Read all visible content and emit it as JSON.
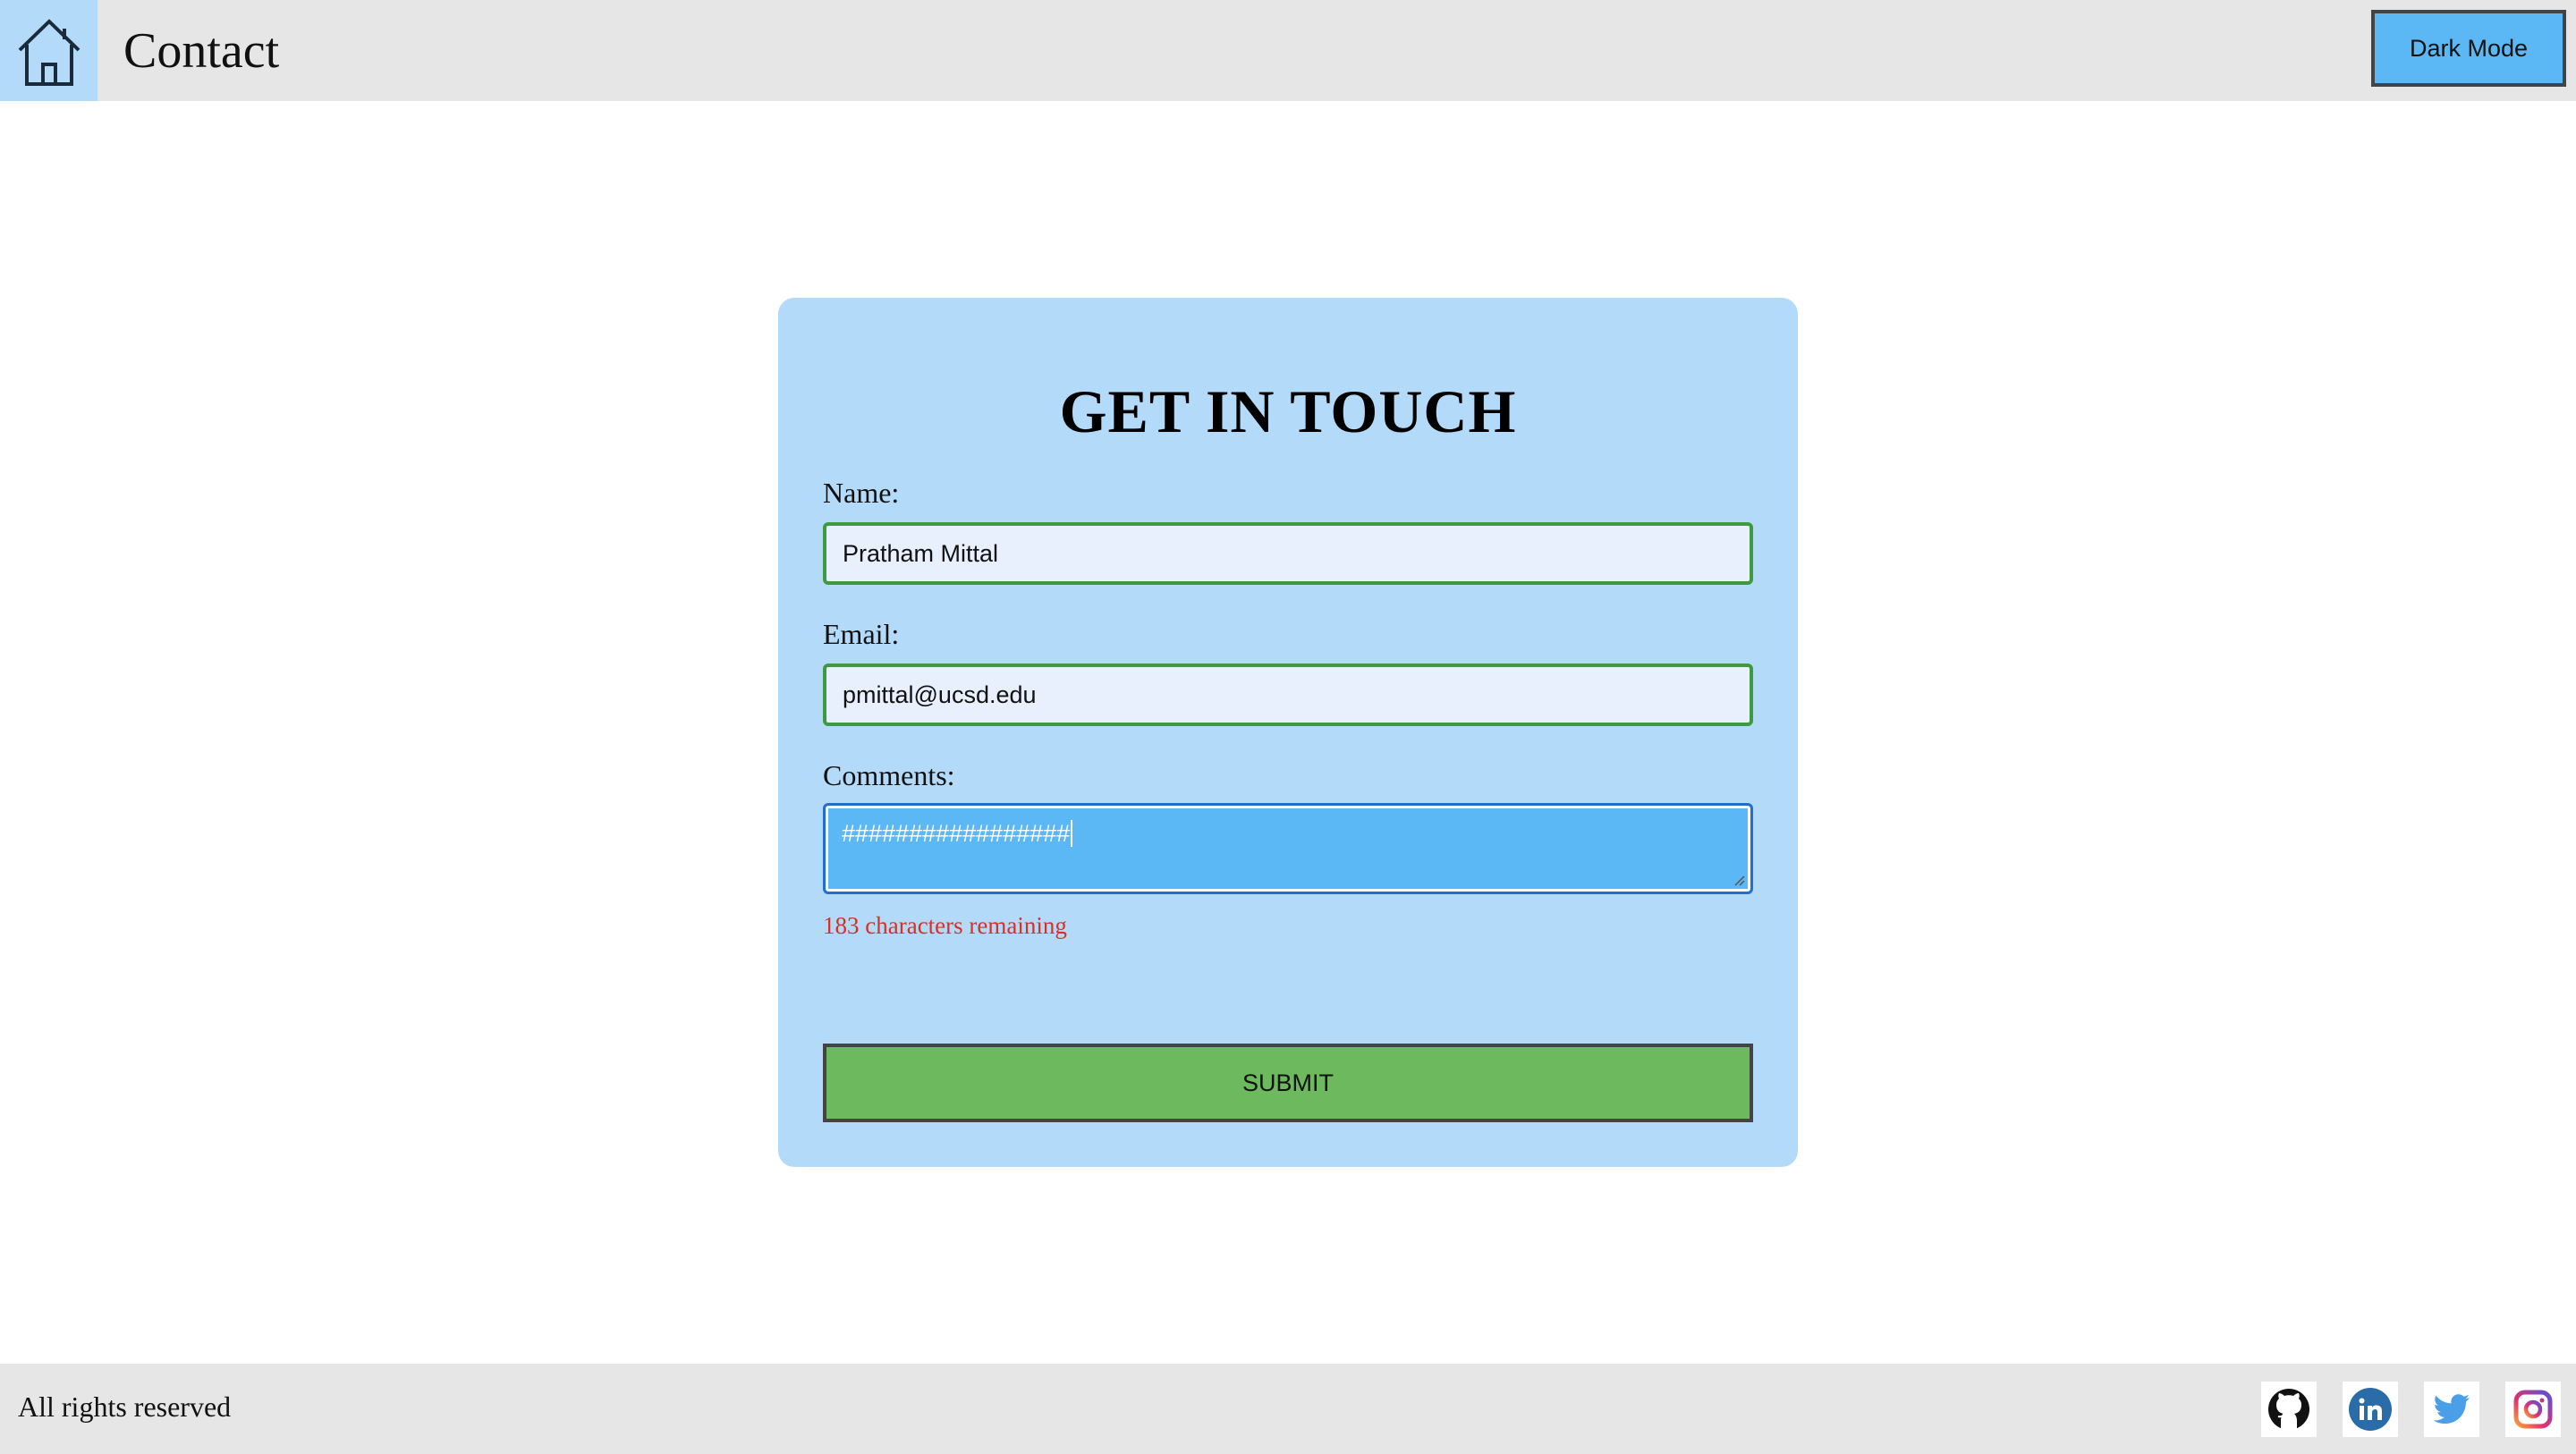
{
  "header": {
    "title": "Contact",
    "dark_mode_label": "Dark Mode"
  },
  "form": {
    "title": "GET IN TOUCH",
    "name_label": "Name:",
    "name_value": "Pratham Mittal",
    "email_label": "Email:",
    "email_value": "pmittal@ucsd.edu",
    "comments_label": "Comments:",
    "comments_value": "#################",
    "remaining_text": "183 characters remaining",
    "submit_label": "SUBMIT"
  },
  "footer": {
    "text": "All rights reserved",
    "social_icons": [
      "github-icon",
      "linkedin-icon",
      "twitter-icon",
      "instagram-icon"
    ]
  },
  "colors": {
    "header_bg": "#e6e6e6",
    "card_bg": "#b3daf9",
    "accent_blue": "#5bb8f5",
    "submit_green": "#6dba5e",
    "error_red": "#d93025"
  }
}
